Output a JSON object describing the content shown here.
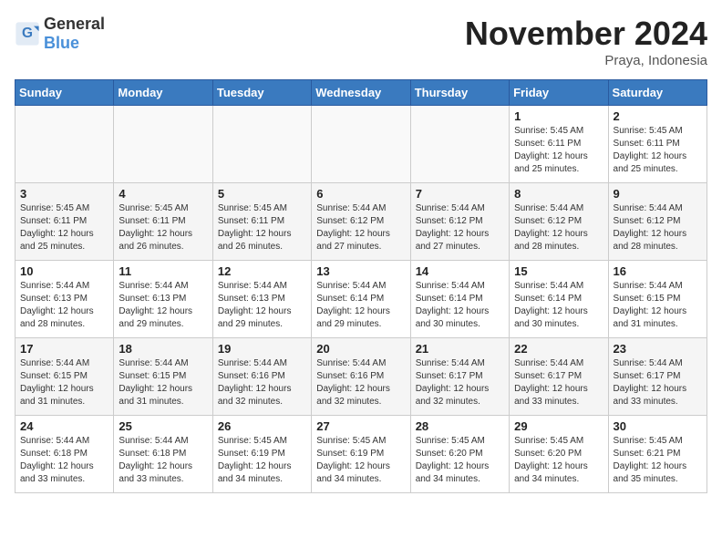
{
  "header": {
    "logo_general": "General",
    "logo_blue": "Blue",
    "month_title": "November 2024",
    "location": "Praya, Indonesia"
  },
  "days_of_week": [
    "Sunday",
    "Monday",
    "Tuesday",
    "Wednesday",
    "Thursday",
    "Friday",
    "Saturday"
  ],
  "weeks": [
    [
      {
        "day": "",
        "info": ""
      },
      {
        "day": "",
        "info": ""
      },
      {
        "day": "",
        "info": ""
      },
      {
        "day": "",
        "info": ""
      },
      {
        "day": "",
        "info": ""
      },
      {
        "day": "1",
        "info": "Sunrise: 5:45 AM\nSunset: 6:11 PM\nDaylight: 12 hours and 25 minutes."
      },
      {
        "day": "2",
        "info": "Sunrise: 5:45 AM\nSunset: 6:11 PM\nDaylight: 12 hours and 25 minutes."
      }
    ],
    [
      {
        "day": "3",
        "info": "Sunrise: 5:45 AM\nSunset: 6:11 PM\nDaylight: 12 hours and 25 minutes."
      },
      {
        "day": "4",
        "info": "Sunrise: 5:45 AM\nSunset: 6:11 PM\nDaylight: 12 hours and 26 minutes."
      },
      {
        "day": "5",
        "info": "Sunrise: 5:45 AM\nSunset: 6:11 PM\nDaylight: 12 hours and 26 minutes."
      },
      {
        "day": "6",
        "info": "Sunrise: 5:44 AM\nSunset: 6:12 PM\nDaylight: 12 hours and 27 minutes."
      },
      {
        "day": "7",
        "info": "Sunrise: 5:44 AM\nSunset: 6:12 PM\nDaylight: 12 hours and 27 minutes."
      },
      {
        "day": "8",
        "info": "Sunrise: 5:44 AM\nSunset: 6:12 PM\nDaylight: 12 hours and 28 minutes."
      },
      {
        "day": "9",
        "info": "Sunrise: 5:44 AM\nSunset: 6:12 PM\nDaylight: 12 hours and 28 minutes."
      }
    ],
    [
      {
        "day": "10",
        "info": "Sunrise: 5:44 AM\nSunset: 6:13 PM\nDaylight: 12 hours and 28 minutes."
      },
      {
        "day": "11",
        "info": "Sunrise: 5:44 AM\nSunset: 6:13 PM\nDaylight: 12 hours and 29 minutes."
      },
      {
        "day": "12",
        "info": "Sunrise: 5:44 AM\nSunset: 6:13 PM\nDaylight: 12 hours and 29 minutes."
      },
      {
        "day": "13",
        "info": "Sunrise: 5:44 AM\nSunset: 6:14 PM\nDaylight: 12 hours and 29 minutes."
      },
      {
        "day": "14",
        "info": "Sunrise: 5:44 AM\nSunset: 6:14 PM\nDaylight: 12 hours and 30 minutes."
      },
      {
        "day": "15",
        "info": "Sunrise: 5:44 AM\nSunset: 6:14 PM\nDaylight: 12 hours and 30 minutes."
      },
      {
        "day": "16",
        "info": "Sunrise: 5:44 AM\nSunset: 6:15 PM\nDaylight: 12 hours and 31 minutes."
      }
    ],
    [
      {
        "day": "17",
        "info": "Sunrise: 5:44 AM\nSunset: 6:15 PM\nDaylight: 12 hours and 31 minutes."
      },
      {
        "day": "18",
        "info": "Sunrise: 5:44 AM\nSunset: 6:15 PM\nDaylight: 12 hours and 31 minutes."
      },
      {
        "day": "19",
        "info": "Sunrise: 5:44 AM\nSunset: 6:16 PM\nDaylight: 12 hours and 32 minutes."
      },
      {
        "day": "20",
        "info": "Sunrise: 5:44 AM\nSunset: 6:16 PM\nDaylight: 12 hours and 32 minutes."
      },
      {
        "day": "21",
        "info": "Sunrise: 5:44 AM\nSunset: 6:17 PM\nDaylight: 12 hours and 32 minutes."
      },
      {
        "day": "22",
        "info": "Sunrise: 5:44 AM\nSunset: 6:17 PM\nDaylight: 12 hours and 33 minutes."
      },
      {
        "day": "23",
        "info": "Sunrise: 5:44 AM\nSunset: 6:17 PM\nDaylight: 12 hours and 33 minutes."
      }
    ],
    [
      {
        "day": "24",
        "info": "Sunrise: 5:44 AM\nSunset: 6:18 PM\nDaylight: 12 hours and 33 minutes."
      },
      {
        "day": "25",
        "info": "Sunrise: 5:44 AM\nSunset: 6:18 PM\nDaylight: 12 hours and 33 minutes."
      },
      {
        "day": "26",
        "info": "Sunrise: 5:45 AM\nSunset: 6:19 PM\nDaylight: 12 hours and 34 minutes."
      },
      {
        "day": "27",
        "info": "Sunrise: 5:45 AM\nSunset: 6:19 PM\nDaylight: 12 hours and 34 minutes."
      },
      {
        "day": "28",
        "info": "Sunrise: 5:45 AM\nSunset: 6:20 PM\nDaylight: 12 hours and 34 minutes."
      },
      {
        "day": "29",
        "info": "Sunrise: 5:45 AM\nSunset: 6:20 PM\nDaylight: 12 hours and 34 minutes."
      },
      {
        "day": "30",
        "info": "Sunrise: 5:45 AM\nSunset: 6:21 PM\nDaylight: 12 hours and 35 minutes."
      }
    ]
  ]
}
